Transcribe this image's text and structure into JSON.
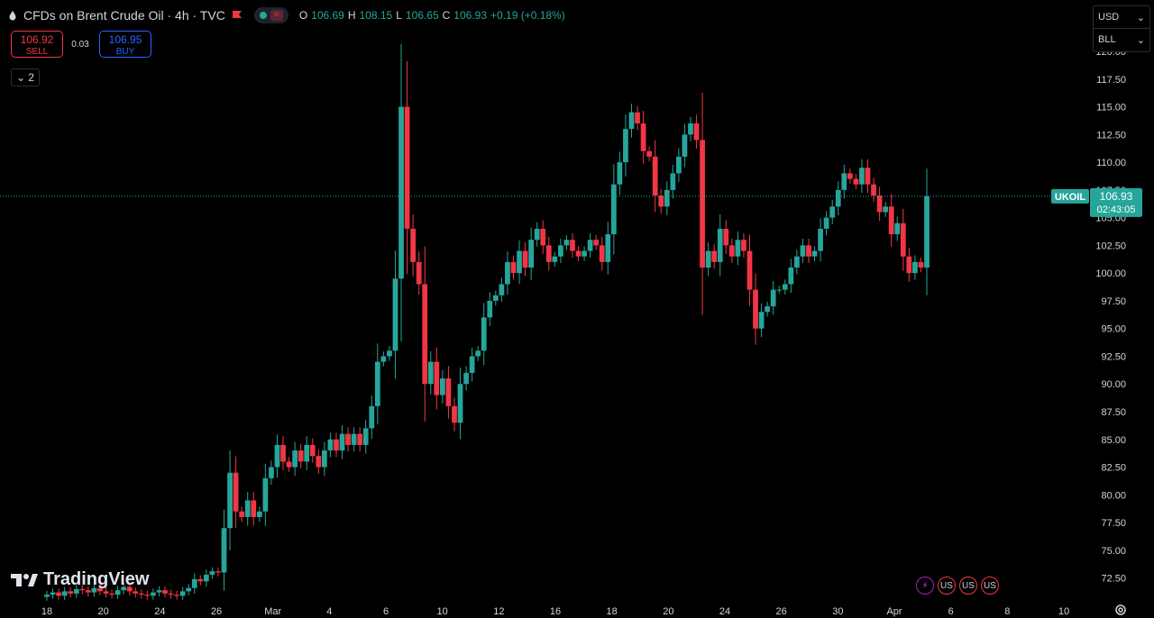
{
  "header": {
    "title": "CFDs on Brent Crude Oil · 4h · TVC",
    "ohlc": [
      {
        "k": "O",
        "v": "106.69"
      },
      {
        "k": "H",
        "v": "108.15"
      },
      {
        "k": "L",
        "v": "106.65"
      },
      {
        "k": "C",
        "v": "106.93"
      }
    ],
    "change": "+0.19 (+0.18%)",
    "wave_glyph": "≈"
  },
  "trade": {
    "sell_price": "106.92",
    "sell_label": "SELL",
    "spread": "0.03",
    "buy_price": "106.95",
    "buy_label": "BUY"
  },
  "collapse": {
    "count": "2",
    "glyph": "⌄"
  },
  "currency": {
    "currency": "USD",
    "unit": "BLL"
  },
  "brand": {
    "name": "TradingView"
  },
  "events": [
    "⚡",
    "US",
    "US",
    "US"
  ],
  "colors": {
    "up": "#26a69a",
    "down": "#f23645",
    "price_line": "#26a69a",
    "grid": "#000000",
    "axis_text": "#d1d4dc"
  },
  "chart_data": {
    "type": "candlestick",
    "symbol_label": "UKOIL",
    "last_price": "106.93",
    "countdown": "02:43:05",
    "last_value": 106.93,
    "ylim": [
      70,
      124
    ],
    "y_ticks": [
      "72.50",
      "75.00",
      "77.50",
      "80.00",
      "82.50",
      "85.00",
      "87.50",
      "90.00",
      "92.50",
      "95.00",
      "97.50",
      "100.00",
      "102.50",
      "105.00",
      "107.50",
      "110.00",
      "112.50",
      "115.00",
      "117.50",
      "120.00"
    ],
    "x_ticks": [
      {
        "label": "18",
        "i": 0
      },
      {
        "label": "20",
        "i": 6
      },
      {
        "label": "24",
        "i": 12
      },
      {
        "label": "26",
        "i": 18
      },
      {
        "label": "Mar",
        "i": 24
      },
      {
        "label": "4",
        "i": 30
      },
      {
        "label": "6",
        "i": 36
      },
      {
        "label": "10",
        "i": 42
      },
      {
        "label": "12",
        "i": 48
      },
      {
        "label": "16",
        "i": 54
      },
      {
        "label": "18",
        "i": 60
      },
      {
        "label": "20",
        "i": 66
      },
      {
        "label": "24",
        "i": 72
      },
      {
        "label": "26",
        "i": 78
      },
      {
        "label": "30",
        "i": 84
      },
      {
        "label": "Apr",
        "i": 90
      },
      {
        "label": "6",
        "i": 96
      },
      {
        "label": "8",
        "i": 102
      },
      {
        "label": "10",
        "i": 108
      }
    ],
    "closes": [
      71.0,
      71.2,
      70.9,
      71.3,
      71.1,
      71.5,
      71.4,
      71.2,
      71.6,
      71.3,
      71.1,
      71.0,
      71.4,
      71.7,
      71.3,
      71.1,
      71.0,
      70.9,
      71.2,
      71.4,
      71.1,
      71.0,
      70.9,
      71.3,
      71.6,
      72.4,
      72.2,
      72.8,
      73.1,
      73.0,
      77.0,
      82.0,
      78.5,
      78.0,
      79.5,
      78.0,
      78.5,
      81.5,
      82.5,
      84.5,
      83.0,
      82.5,
      84.0,
      83.0,
      84.5,
      83.5,
      82.5,
      84.0,
      85.0,
      84.0,
      85.5,
      84.5,
      85.5,
      84.5,
      86.0,
      88.0,
      92.0,
      92.5,
      93.0,
      99.5,
      115.0,
      104.0,
      101.0,
      99.0,
      90.0,
      92.0,
      89.0,
      90.5,
      88.0,
      86.5,
      90.0,
      91.0,
      92.5,
      93.0,
      96.0,
      97.5,
      98.0,
      99.0,
      101.0,
      100.0,
      102.0,
      100.5,
      103.0,
      104.0,
      102.5,
      101.0,
      101.5,
      102.5,
      103.0,
      102.0,
      101.5,
      102.0,
      103.0,
      102.5,
      101.0,
      103.5,
      108.0,
      110.0,
      113.0,
      114.5,
      113.5,
      111.0,
      110.5,
      107.0,
      106.0,
      107.5,
      109.0,
      110.5,
      112.5,
      113.5,
      112.0,
      100.5,
      102.0,
      101.0,
      104.0,
      102.5,
      101.5,
      103.0,
      102.0,
      98.5,
      95.0,
      96.5,
      97.0,
      98.5,
      98.5,
      99.0,
      100.5,
      101.5,
      102.5,
      101.5,
      102.0,
      104.0,
      105.0,
      106.0,
      107.5,
      109.0,
      108.5,
      108.0,
      109.5,
      108.0,
      107.0,
      105.5,
      106.0,
      103.5,
      104.5,
      101.5,
      100.0,
      101.0,
      100.5,
      106.93
    ]
  }
}
